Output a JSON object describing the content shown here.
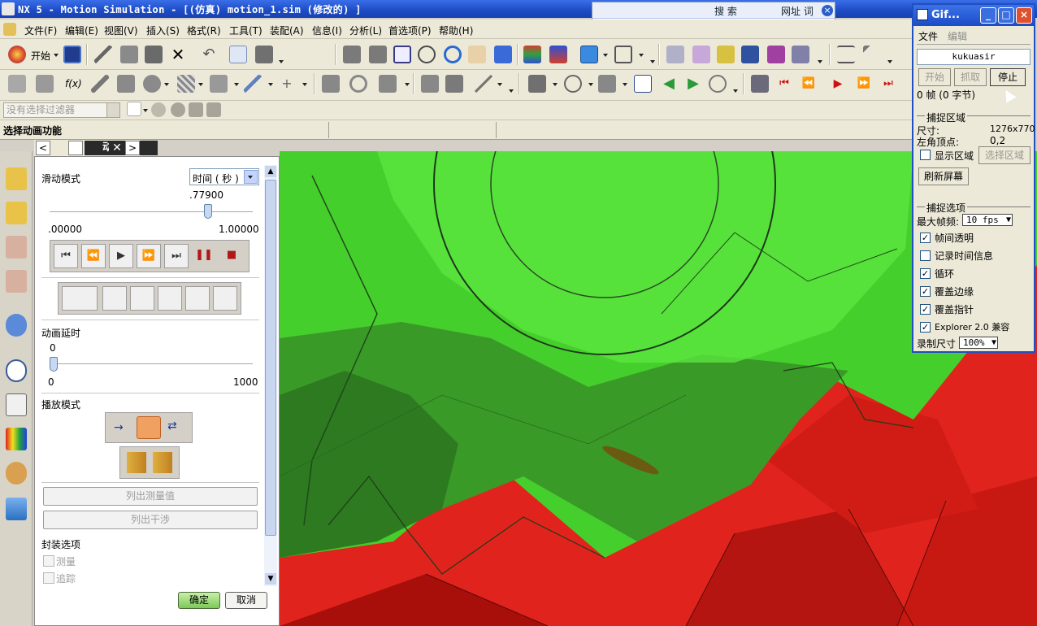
{
  "window": {
    "title": "NX 5 - Motion Simulation - [(仿真) motion_1.sim (修改的) ]"
  },
  "search_overlay": {
    "search_label": "搜 索",
    "url_label": "网址 词",
    "close": "×",
    "go": "⊡"
  },
  "menu": {
    "items": [
      "文件(F)",
      "编辑(E)",
      "视图(V)",
      "插入(S)",
      "格式(R)",
      "工具(T)",
      "装配(A)",
      "信息(I)",
      "分析(L)",
      "首选项(P)",
      "帮助(H)"
    ]
  },
  "toolbar": {
    "start_label": "开始",
    "formula_label": "f(x)"
  },
  "filter": {
    "placeholder": "没有选择过滤器"
  },
  "status": {
    "prompt": "选择动画功能"
  },
  "anim_panel": {
    "tab_title": "动画",
    "tab_close": "✕",
    "nav_prev": "<",
    "nav_next": ">",
    "slide_mode_label": "滑动模式",
    "slide_mode_value": "时间 ( 秒 )",
    "slider_value": ".77900",
    "slider_fraction": 0.779,
    "slider_min": ".00000",
    "slider_max": "1.00000",
    "delay_label": "动画延时",
    "delay_value": "0",
    "delay_min": "0",
    "delay_max": "1000",
    "play_mode_label": "播放模式",
    "list_measure": "列出测量值",
    "list_interference": "列出干涉",
    "package_options": "封装选项",
    "opt_measure": "测量",
    "opt_trace": "追踪",
    "ok": "确定",
    "cancel": "取消",
    "playback": {
      "first": "⏮",
      "prev": "⏪",
      "play": "▶",
      "next": "⏩",
      "last": "⏭",
      "pause": "❚❚",
      "stop": "■"
    }
  },
  "gif_window": {
    "title": "Gif...",
    "menu_file": "文件",
    "menu_edit": "编辑",
    "user": "kukuasir",
    "btn_start": "开始",
    "btn_capture": "抓取",
    "btn_stop": "停止",
    "frames_info": "0 帧 (0 字节)",
    "capture_area_header": "捕捉区域",
    "size_label": "尺寸:",
    "size_value": "1276x770",
    "origin_label": "左角顶点:",
    "origin_value": "0,2",
    "show_area": "显示区域",
    "select_area": "选择区域",
    "refresh": "刷新屏幕",
    "capture_options_header": "捕捉选项",
    "max_fps_label": "最大帧频:",
    "max_fps_value": "10 fps",
    "opt_frame_transparent": "帧间透明",
    "opt_record_time": "记录时间信息",
    "opt_loop": "循环",
    "opt_cover_edge": "覆盖边缘",
    "opt_cover_pointer": "覆盖指针",
    "opt_explorer": "Explorer 2.0 兼容",
    "record_size_label": "录制尺寸",
    "record_size_value": "100%",
    "check_mark": "✓",
    "minimize": "_",
    "maximize": "□",
    "close": "×"
  },
  "colors": {
    "titlebar": "#1c4bc4",
    "gear_red": "#e0241d",
    "gear_green": "#45cf2c"
  }
}
